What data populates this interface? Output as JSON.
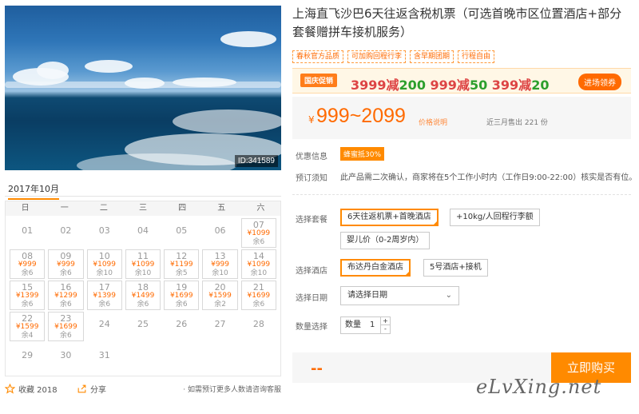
{
  "product": {
    "title": "上海直飞沙巴6天往返含税机票（可选首晚市区位置酒店+部分套餐赠拼车接机服务）",
    "image_id": "ID:341589",
    "tags": [
      "春秋官方品质",
      "可加购回程行李",
      "含早期团期",
      "行程自由"
    ]
  },
  "promo": {
    "badge": "国庆促销",
    "offers": [
      {
        "prefix": "3999减",
        "amount": "200"
      },
      {
        "prefix": "999减",
        "amount": "50"
      },
      {
        "prefix": "399减",
        "amount": "20"
      }
    ],
    "claim_button": "进场领券"
  },
  "price": {
    "currency": "¥",
    "range": "999~2099",
    "explain_link": "价格说明",
    "sold": "近三月售出 221 份"
  },
  "info": {
    "discount_label": "优惠信息",
    "discount_badge": "蜂蜜抵30%",
    "booking_label": "预订须知",
    "booking_text": "此产品需二次确认，商家将在5个工作小时内（工作日9:00-22:00）核实是否有位。"
  },
  "options": {
    "package_label": "选择套餐",
    "packages": [
      "6天往返机票+首晚酒店",
      "+10kg/人回程行李额",
      "婴儿价（0-2周岁内）"
    ],
    "hotel_label": "选择酒店",
    "hotels": [
      "布达丹白金酒店",
      "5号酒店+接机"
    ],
    "date_label": "选择日期",
    "date_placeholder": "请选择日期",
    "qty_label": "数量选择",
    "qty_text": "数量",
    "qty_value": "1",
    "qty_up": "+",
    "qty_down": "-"
  },
  "buy": {
    "price_placeholder": "--",
    "button": "立即购买"
  },
  "calendar": {
    "month": "2017年10月",
    "weekdays": [
      "日",
      "一",
      "二",
      "三",
      "四",
      "五",
      "六"
    ],
    "days": [
      {
        "d": "01"
      },
      {
        "d": "02"
      },
      {
        "d": "03"
      },
      {
        "d": "04"
      },
      {
        "d": "05"
      },
      {
        "d": "06"
      },
      {
        "d": "07",
        "p": "¥1099",
        "s": "余6"
      },
      {
        "d": "08",
        "p": "¥999",
        "s": "余6"
      },
      {
        "d": "09",
        "p": "¥999",
        "s": "余6"
      },
      {
        "d": "10",
        "p": "¥1099",
        "s": "余10"
      },
      {
        "d": "11",
        "p": "¥1099",
        "s": "余10"
      },
      {
        "d": "12",
        "p": "¥1199",
        "s": "余5"
      },
      {
        "d": "13",
        "p": "¥999",
        "s": "余10"
      },
      {
        "d": "14",
        "p": "¥1099",
        "s": "余10"
      },
      {
        "d": "15",
        "p": "¥1399",
        "s": "余6"
      },
      {
        "d": "16",
        "p": "¥1299",
        "s": "余6"
      },
      {
        "d": "17",
        "p": "¥1399",
        "s": "余6"
      },
      {
        "d": "18",
        "p": "¥1499",
        "s": "余6"
      },
      {
        "d": "19",
        "p": "¥1699",
        "s": "余6"
      },
      {
        "d": "20",
        "p": "¥1599",
        "s": "余2"
      },
      {
        "d": "21",
        "p": "¥1699",
        "s": "余6"
      },
      {
        "d": "22",
        "p": "¥1599",
        "s": "余4"
      },
      {
        "d": "23",
        "p": "¥1699",
        "s": "余6"
      },
      {
        "d": "24"
      },
      {
        "d": "25"
      },
      {
        "d": "26"
      },
      {
        "d": "27"
      },
      {
        "d": "28"
      },
      {
        "d": "29"
      },
      {
        "d": "30"
      },
      {
        "d": "31"
      }
    ]
  },
  "footer": {
    "favorite": "收藏 2018",
    "share": "分享",
    "note": "· 如需预订更多人数请咨询客服"
  },
  "watermark": "eLvXing.net",
  "colors": {
    "accent": "#ff8a00",
    "price": "#ff6a00",
    "offer_amount": "#2c9f2c",
    "offer_prefix": "#dd4444"
  }
}
